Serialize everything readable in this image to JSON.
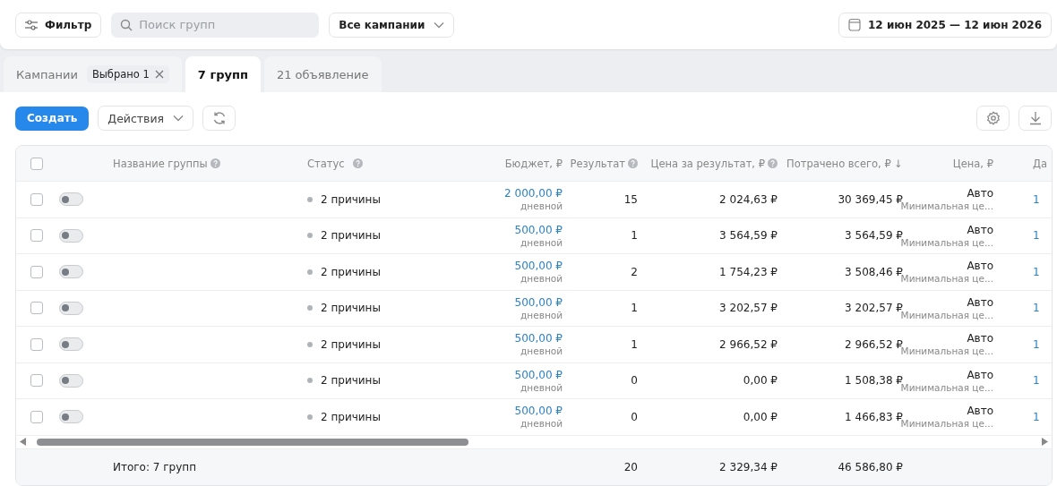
{
  "toolbar": {
    "filter_button": "Фильтр",
    "search": {
      "placeholder": "Поиск групп"
    },
    "campaign_select": "Все кампании",
    "date_range": "12 июн 2025 — 12 июн 2026"
  },
  "tabs": [
    {
      "label": "Кампании",
      "chip": "Выбрано 1",
      "selected": false
    },
    {
      "label": "7 групп",
      "selected": true
    },
    {
      "label": "21 объявление",
      "selected": false
    }
  ],
  "actions": {
    "create_button": "Создать",
    "actions_select": "Действия"
  },
  "table": {
    "select_all_checked": false,
    "columns": [
      {
        "label": "Название группы",
        "help": true
      },
      {
        "label": "Статус",
        "help": true
      },
      {
        "label": "Бюджет, ₽",
        "help": false
      },
      {
        "label": "Результат",
        "help": true
      },
      {
        "label": "Цена за результат, ₽",
        "help": true
      },
      {
        "label": "Потрачено всего, ₽ ↓",
        "help": false
      },
      {
        "label": "Цена, ₽",
        "help": false
      },
      {
        "label": "Да",
        "help": false
      }
    ],
    "rows": [
      {
        "checked": false,
        "on": false,
        "status": "2 причины",
        "budget": "2 000,00 ₽",
        "budget_period": "дневной",
        "result": "15",
        "cost_per_result": "2 024,63 ₽",
        "spent": "30 369,45 ₽",
        "price": "Авто",
        "price_note": "Минимальная це...",
        "column_10": "1"
      },
      {
        "checked": false,
        "on": false,
        "status": "2 причины",
        "budget": "500,00 ₽",
        "budget_period": "дневной",
        "result": "1",
        "cost_per_result": "3 564,59 ₽",
        "spent": "3 564,59 ₽",
        "price": "Авто",
        "price_note": "Минимальная це...",
        "column_10": "1"
      },
      {
        "checked": false,
        "on": false,
        "status": "2 причины",
        "budget": "500,00 ₽",
        "budget_period": "дневной",
        "result": "2",
        "cost_per_result": "1 754,23 ₽",
        "spent": "3 508,46 ₽",
        "price": "Авто",
        "price_note": "Минимальная це...",
        "column_10": "1"
      },
      {
        "checked": false,
        "on": false,
        "status": "2 причины",
        "budget": "500,00 ₽",
        "budget_period": "дневной",
        "result": "1",
        "cost_per_result": "3 202,57 ₽",
        "spent": "3 202,57 ₽",
        "price": "Авто",
        "price_note": "Минимальная це...",
        "column_10": "1"
      },
      {
        "checked": false,
        "on": false,
        "status": "2 причины",
        "budget": "500,00 ₽",
        "budget_period": "дневной",
        "result": "1",
        "cost_per_result": "2 966,52 ₽",
        "spent": "2 966,52 ₽",
        "price": "Авто",
        "price_note": "Минимальная це...",
        "column_10": "1"
      },
      {
        "checked": false,
        "on": false,
        "status": "2 причины",
        "budget": "500,00 ₽",
        "budget_period": "дневной",
        "result": "0",
        "cost_per_result": "0,00 ₽",
        "spent": "1 508,38 ₽",
        "price": "Авто",
        "price_note": "Минимальная це...",
        "column_10": "1"
      },
      {
        "checked": false,
        "on": false,
        "status": "2 причины",
        "budget": "500,00 ₽",
        "budget_period": "дневной",
        "result": "0",
        "cost_per_result": "0,00 ₽",
        "spent": "1 466,83 ₽",
        "price": "Авто",
        "price_note": "Минимальная це...",
        "column_10": "1"
      }
    ],
    "totals": {
      "label": "Итого: 7 групп",
      "result": "20",
      "cost_per_result": "2 329,34 ₽",
      "spent": "46 586,80 ₽"
    }
  }
}
